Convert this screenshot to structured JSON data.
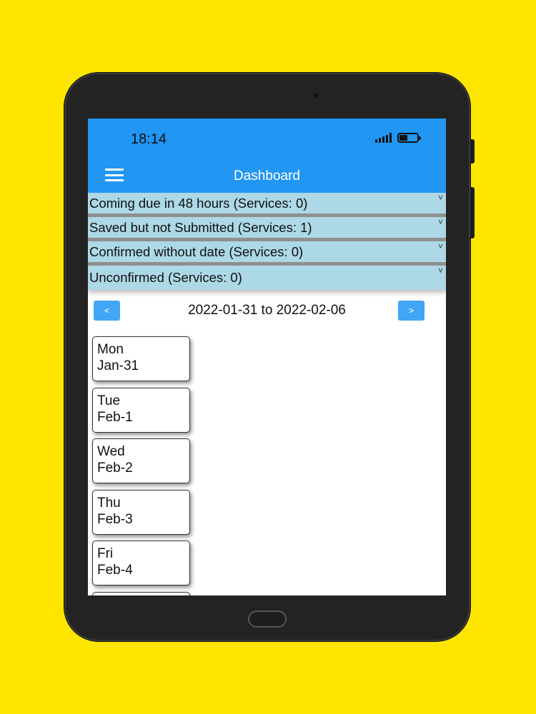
{
  "status_bar": {
    "time": "18:14"
  },
  "app_bar": {
    "title": "Dashboard",
    "menu_icon": "menu-icon"
  },
  "sections": [
    {
      "label": "Coming due in 48 hours (Services: 0)"
    },
    {
      "label": "Saved but not Submitted (Services: 1)"
    },
    {
      "label": "Confirmed without date (Services: 0)"
    },
    {
      "label": "Unconfirmed (Services: 0)"
    }
  ],
  "week_nav": {
    "range": "2022-01-31 to 2022-02-06",
    "prev_icon": "chevron-left-icon",
    "next_icon": "chevron-right-icon"
  },
  "days": [
    {
      "weekday": "Mon",
      "date": "Jan-31"
    },
    {
      "weekday": "Tue",
      "date": "Feb-1"
    },
    {
      "weekday": "Wed",
      "date": "Feb-2"
    },
    {
      "weekday": "Thu",
      "date": "Feb-3"
    },
    {
      "weekday": "Fri",
      "date": "Feb-4"
    },
    {
      "weekday": "",
      "date": ""
    }
  ],
  "colors": {
    "background": "#FFE600",
    "app_bar": "#2196F3",
    "section": "#ADD8E6",
    "nav_button": "#42A5F5"
  }
}
